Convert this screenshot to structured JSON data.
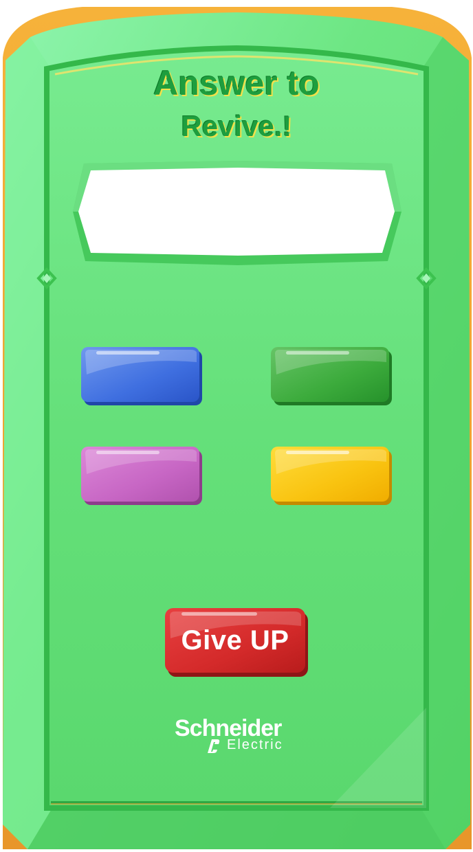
{
  "dialog": {
    "title_line1": "Answer to",
    "title_line2": "Revive.!",
    "answer_text": ""
  },
  "options": [
    {
      "id": "a",
      "label": "",
      "color": "#3f6fe0",
      "color_dark": "#1f47a8"
    },
    {
      "id": "b",
      "label": "",
      "color": "#3cab3c",
      "color_dark": "#1f7a25"
    },
    {
      "id": "c",
      "label": "",
      "color": "#c766c4",
      "color_dark": "#8e3c8c"
    },
    {
      "id": "d",
      "label": "",
      "color": "#f9c310",
      "color_dark": "#c48a00"
    }
  ],
  "give_up": {
    "label": "Give UP",
    "color": "#d42a2a"
  },
  "brand": {
    "name": "Schneider",
    "sub": "Electric",
    "icon": "schneider-logo-icon"
  },
  "colors": {
    "panel_green": "#66e27a",
    "panel_light": "#8ef2a6",
    "panel_border": "#3cc24f",
    "outer_gold": "#f3a92d",
    "title_green": "#1e9e3e"
  }
}
